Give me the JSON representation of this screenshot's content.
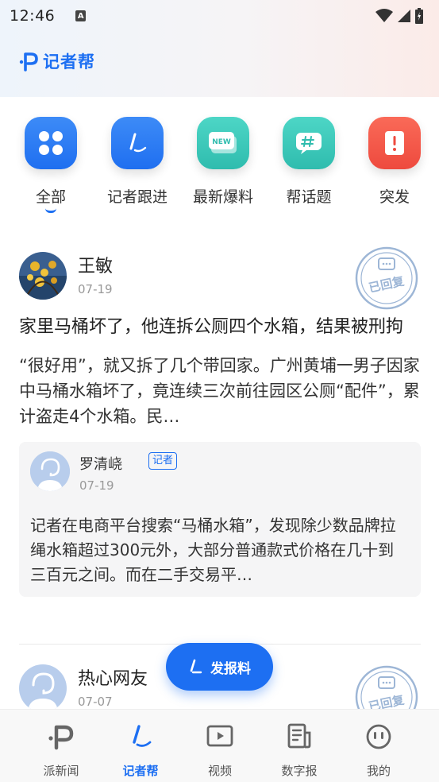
{
  "status_bar": {
    "time": "12:46",
    "notification_icon": "A"
  },
  "brand": {
    "name": "记者帮",
    "logo_icon": "p-logo-icon"
  },
  "categories": [
    {
      "label": "全部",
      "icon": "grid-icon",
      "color": "#2f7df5",
      "active": true
    },
    {
      "label": "记者跟进",
      "icon": "pen-icon",
      "color": "#2f7df5",
      "active": false
    },
    {
      "label": "最新爆料",
      "icon": "new-icon",
      "badge_text": "NEW",
      "color": "#3cc7b8",
      "active": false
    },
    {
      "label": "帮话题",
      "icon": "hashtag-icon",
      "color": "#3cc7b8",
      "active": false
    },
    {
      "label": "突发",
      "icon": "alert-icon",
      "color": "#f2574b",
      "active": false
    }
  ],
  "posts": [
    {
      "author": "王敏",
      "date": "07-19",
      "stamp": "已回复",
      "title": "家里马桶坏了，他连拆公厕四个水箱，结果被刑拘",
      "body": "“很好用”，就又拆了几个带回家。广州黄埔一男子因家中马桶水箱坏了，竟连续三次前往园区公厕“配件”，累计盗走4个水箱。民…",
      "reply": {
        "name": "罗清峣",
        "badge": "记者",
        "date": "07-19",
        "text": "记者在电商平台搜索“马桶水箱”，发现除少数品牌拉绳水箱超过300元外，大部分普通款式价格在几十到三百元之间。而在二手交易平…"
      }
    },
    {
      "author": "热心网友",
      "date": "07-07",
      "stamp": "已回复"
    }
  ],
  "fab": {
    "label": "发报料",
    "icon": "pen-icon"
  },
  "tabbar": [
    {
      "label": "派新闻",
      "icon": "p-logo-icon",
      "active": false
    },
    {
      "label": "记者帮",
      "icon": "pen-icon",
      "active": true
    },
    {
      "label": "视频",
      "icon": "play-icon",
      "active": false
    },
    {
      "label": "数字报",
      "icon": "newspaper-icon",
      "active": false
    },
    {
      "label": "我的",
      "icon": "profile-icon",
      "active": false
    }
  ],
  "colors": {
    "accent": "#1d6ff2",
    "text": "#222222",
    "muted": "#999999"
  }
}
